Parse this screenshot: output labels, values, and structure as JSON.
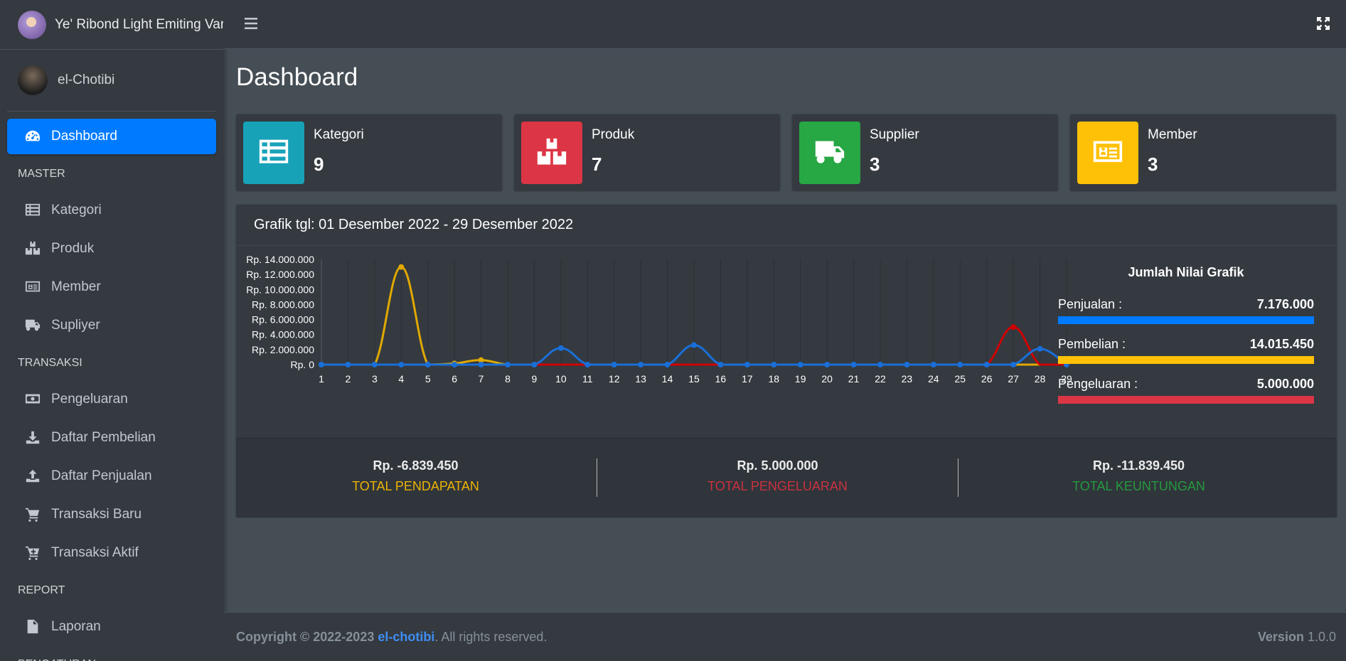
{
  "brand": {
    "title": "Ye' Ribond Light Emiting Vari"
  },
  "user": {
    "name": "el-Chotibi"
  },
  "sidebar": {
    "items": [
      {
        "type": "item",
        "label": "Dashboard",
        "icon": "tachometer-icon",
        "active": true
      },
      {
        "type": "header",
        "label": "MASTER"
      },
      {
        "type": "item",
        "label": "Kategori",
        "icon": "table-list-icon"
      },
      {
        "type": "item",
        "label": "Produk",
        "icon": "cubes-icon"
      },
      {
        "type": "item",
        "label": "Member",
        "icon": "id-card-icon"
      },
      {
        "type": "item",
        "label": "Supliyer",
        "icon": "truck-icon"
      },
      {
        "type": "header",
        "label": "TRANSAKSI"
      },
      {
        "type": "item",
        "label": "Pengeluaran",
        "icon": "money-bill-icon"
      },
      {
        "type": "item",
        "label": "Daftar Pembelian",
        "icon": "download-icon"
      },
      {
        "type": "item",
        "label": "Daftar Penjualan",
        "icon": "upload-icon"
      },
      {
        "type": "item",
        "label": "Transaksi Baru",
        "icon": "cart-icon"
      },
      {
        "type": "item",
        "label": "Transaksi Aktif",
        "icon": "cart-plus-icon"
      },
      {
        "type": "header",
        "label": "REPORT"
      },
      {
        "type": "item",
        "label": "Laporan",
        "icon": "file-icon"
      },
      {
        "type": "header",
        "label": "PENGATURAN"
      }
    ]
  },
  "page": {
    "title": "Dashboard"
  },
  "info_boxes": [
    {
      "label": "Kategori",
      "value": "9",
      "color": "#17a2b8",
      "icon": "table-list-icon"
    },
    {
      "label": "Produk",
      "value": "7",
      "color": "#dc3545",
      "icon": "cubes-icon"
    },
    {
      "label": "Supplier",
      "value": "3",
      "color": "#28a745",
      "icon": "truck-icon"
    },
    {
      "label": "Member",
      "value": "3",
      "color": "#ffc107",
      "icon": "id-card-icon"
    }
  ],
  "chart_card": {
    "title": "Grafik tgl: 01 Desember 2022 - 29 Desember 2022"
  },
  "chart_data": {
    "type": "line",
    "categories": [
      "1",
      "2",
      "3",
      "4",
      "5",
      "6",
      "7",
      "8",
      "9",
      "10",
      "11",
      "12",
      "13",
      "14",
      "15",
      "16",
      "17",
      "18",
      "19",
      "20",
      "21",
      "22",
      "23",
      "24",
      "25",
      "26",
      "27",
      "28",
      "29"
    ],
    "ylim": [
      0,
      14000000
    ],
    "yticks": [
      "Rp. 0",
      "Rp. 2.000.000",
      "Rp. 4.000.000",
      "Rp. 6.000.000",
      "Rp. 8.000.000",
      "Rp. 10.000.000",
      "Rp. 12.000.000",
      "Rp. 14.000.000"
    ],
    "grid": true,
    "series": [
      {
        "color": "#e0a800",
        "values": [
          0,
          0,
          0,
          13000000,
          0,
          150000,
          600000,
          0,
          0,
          0,
          0,
          0,
          0,
          0,
          0,
          0,
          0,
          0,
          0,
          0,
          0,
          0,
          0,
          0,
          0,
          0,
          0,
          0,
          0
        ]
      },
      {
        "color": "#d00000",
        "values": [
          0,
          0,
          0,
          0,
          0,
          0,
          0,
          0,
          0,
          0,
          0,
          0,
          0,
          0,
          0,
          0,
          0,
          0,
          0,
          0,
          0,
          0,
          0,
          0,
          0,
          0,
          5000000,
          0,
          0
        ]
      },
      {
        "color": "#1a6fd8",
        "values": [
          0,
          0,
          0,
          0,
          0,
          0,
          0,
          0,
          0,
          2200000,
          0,
          0,
          0,
          0,
          2600000,
          0,
          0,
          0,
          0,
          0,
          0,
          0,
          0,
          0,
          0,
          0,
          0,
          2100000,
          0
        ]
      }
    ]
  },
  "summary": {
    "title": "Jumlah Nilai Grafik",
    "rows": [
      {
        "label": "Penjualan :",
        "value": "7.176.000",
        "color": "#007bff"
      },
      {
        "label": "Pembelian :",
        "value": "14.015.450",
        "color": "#ffc107"
      },
      {
        "label": "Pengeluaran :",
        "value": "5.000.000",
        "color": "#dc3545"
      }
    ]
  },
  "totals": [
    {
      "value": "Rp. -6.839.450",
      "label": "TOTAL PENDAPATAN",
      "color": "#ffc107"
    },
    {
      "value": "Rp. 5.000.000",
      "label": "TOTAL PENGELUARAN",
      "color": "#dc3545"
    },
    {
      "value": "Rp. -11.839.450",
      "label": "TOTAL KEUNTUNGAN",
      "color": "#28a745"
    }
  ],
  "footer": {
    "copyright": "Copyright © 2022-2023",
    "author": "el-chotibi",
    "rights": ". All rights reserved.",
    "version_label": "Version",
    "version": "1.0.0"
  }
}
